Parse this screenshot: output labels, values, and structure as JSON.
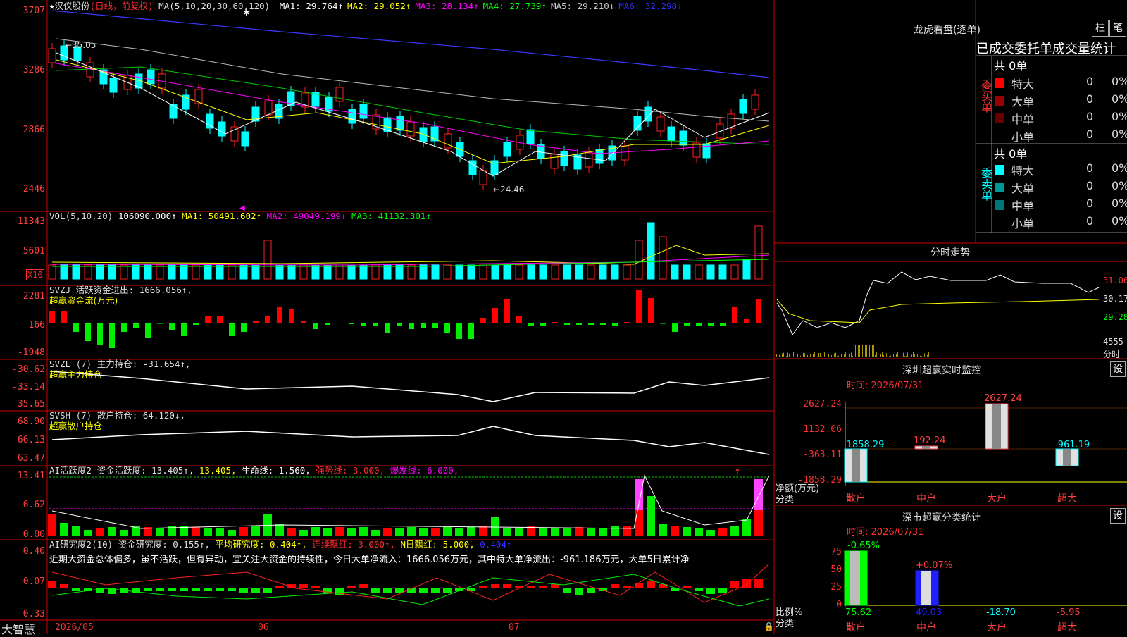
{
  "stock": {
    "name": "汉仪股份",
    "period": "(日线，前复权)",
    "ma_title": "MA(5,10,20,30,60,120)",
    "ma": [
      {
        "label": "MA1:",
        "value": "29.764↑",
        "color": "#ffffff"
      },
      {
        "label": "MA2:",
        "value": "29.052↑",
        "color": "#ffff00"
      },
      {
        "label": "MA3:",
        "value": "28.134↑",
        "color": "#ff00ff"
      },
      {
        "label": "MA4:",
        "value": "27.739↑",
        "color": "#00ff00"
      },
      {
        "label": "MA5:",
        "value": "29.210↓",
        "color": "#cccccc"
      },
      {
        "label": "MA6:",
        "value": "32.298↓",
        "color": "#3030ff"
      }
    ],
    "high_mark": "←35.05",
    "low_mark": "←24.46"
  },
  "price_axis": [
    "3707",
    "3286",
    "2866",
    "2446"
  ],
  "vol": {
    "title": "VOL(5,10,20)",
    "value": "106090.000↑",
    "ma1": "MA1: 50491.602↑",
    "ma2": "MA2: 49049.199↓",
    "ma3": "MA3: 41132.301↑",
    "axis": [
      "11343",
      "5601"
    ],
    "unit": "X10"
  },
  "svzj": {
    "title": "SVZJ  活跃资金进出: 1666.056↑,",
    "sub": "超赢资金流(万元)",
    "axis": [
      "2281",
      "166",
      "-1948"
    ]
  },
  "svzl": {
    "title": "SVZL (7) 主力持仓: -31.654↑,",
    "sub": "超赢主力持仓",
    "axis": [
      "-30.62",
      "-33.14",
      "-35.65"
    ]
  },
  "svsh": {
    "title": "SVSH (7) 散户持仓: 64.120↓,",
    "sub": "超赢散户持仓",
    "axis": [
      "68.90",
      "66.13",
      "63.47"
    ]
  },
  "ai_active": {
    "title": "AI活跃度2 资金活跃度: 13.405↑,",
    "v2": "13.405,",
    "life": "生命线: 1.560,",
    "strong": "强势线: 3.000,",
    "burst": "爆发线: 6.000,",
    "axis": [
      "13.41",
      "6.62",
      "0.00"
    ]
  },
  "ai_research": {
    "title": "AI研究度2(10) 资金研究度: 0.155↑,",
    "avg": "平均研究度: 0.404↑,",
    "lian": "连续飘红: 3.000↑,",
    "nday": "N日飘红: 5.000,",
    "tail": "0.404↑",
    "comment": "近期大资金总体偏多，虽不活跃，但有异动，宜关注大资金的持续性，今日大单净流入：1666.056万元，其中特大单净流出：-961.186万元，大单5日累计净",
    "axis": [
      "0.46",
      "0.07",
      "-0.33"
    ]
  },
  "bottom": {
    "brand": "大智慧",
    "dates": [
      "2026/05",
      "06",
      "07"
    ]
  },
  "dragon": {
    "title": "龙虎看盘(逐单)",
    "btn1": "柱",
    "btn2": "笔",
    "header": "已成交委托单成交量统计",
    "buy_label": "委买单",
    "sell_label": "委卖单",
    "buy_total": "共 0单",
    "sell_total": "共 0单",
    "buy_rows": [
      {
        "name": "特大",
        "count": "0",
        "pct": "0%",
        "color": "#ff0000"
      },
      {
        "name": "大单",
        "count": "0",
        "pct": "0%",
        "color": "#990000"
      },
      {
        "name": "中单",
        "count": "0",
        "pct": "0%",
        "color": "#660000"
      },
      {
        "name": "小单",
        "count": "0",
        "pct": "0%",
        "color": "#000000"
      }
    ],
    "sell_rows": [
      {
        "name": "特大",
        "count": "0",
        "pct": "0%",
        "color": "#00ffff"
      },
      {
        "name": "大单",
        "count": "0",
        "pct": "0%",
        "color": "#009999"
      },
      {
        "name": "中单",
        "count": "0",
        "pct": "0%",
        "color": "#007777"
      },
      {
        "name": "小单",
        "count": "0",
        "pct": "0%",
        "color": "#000000"
      }
    ]
  },
  "intraday": {
    "title": "分时走势",
    "axis": [
      "31.06",
      "30.17",
      "29.28",
      "4555"
    ],
    "unit": "分时"
  },
  "monitor": {
    "title": "深圳超赢实时监控",
    "btn": "设",
    "time": "时间: 2026/07/31",
    "axis": [
      "2627.24",
      "1132.06",
      "-363.11",
      "-1858.29"
    ],
    "ylabel": "净额(万元)",
    "xlabel": "分类",
    "cats": [
      "散户",
      "中户",
      "大户",
      "超大"
    ],
    "values": [
      -1858.29,
      192.24,
      2627.24,
      -961.19
    ],
    "value_labels": [
      "-1858.29",
      "192.24",
      "2627.24",
      "-961.19"
    ]
  },
  "classify": {
    "title": "深市超赢分类统计",
    "btn": "设",
    "time": "时间: 2026/07/31",
    "axis": [
      "75",
      "50",
      "25",
      "0"
    ],
    "ylabel": "比例%",
    "xlabel": "分类",
    "cats": [
      "散户",
      "中户",
      "大户",
      "超大"
    ],
    "top_labels": [
      "-0.65%",
      "+0.07%"
    ],
    "bottom_values": [
      "75.62",
      "49.03",
      "-18.70",
      "-5.95"
    ]
  }
}
